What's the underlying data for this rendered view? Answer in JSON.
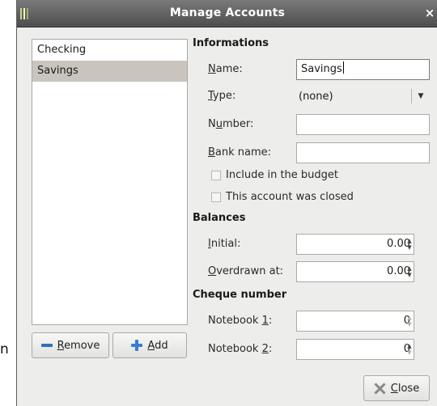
{
  "background": {
    "letter": "n"
  },
  "window": {
    "title": "Manage Accounts",
    "close_glyph": "×"
  },
  "accounts": [
    "Checking",
    "Savings"
  ],
  "selected_account": "Savings",
  "buttons": {
    "remove_u": "R",
    "remove_rest": "emove",
    "add_u": "A",
    "add_rest": "dd",
    "close_u": "C",
    "close_rest": "lose"
  },
  "informations": {
    "heading": "Informations",
    "name_u": "N",
    "name_rest": "ame:",
    "name_value": "Savings",
    "type_u": "T",
    "type_rest": "ype:",
    "type_value": "(none)",
    "number_a": "N",
    "number_u": "u",
    "number_rest": "mber:",
    "number_value": "",
    "bank_u": "B",
    "bank_rest": "ank name:",
    "bank_value": "",
    "include_budget_label": "Include in the budget",
    "include_budget_checked": false,
    "closed_label": "This account was closed",
    "closed_checked": false
  },
  "balances": {
    "heading": "Balances",
    "initial_u": "I",
    "initial_rest": "nitial:",
    "initial_value": "0.00",
    "overdrawn_u": "O",
    "overdrawn_rest": "verdrawn at:",
    "overdrawn_value": "0.00"
  },
  "cheque": {
    "heading": "Cheque number",
    "nb1_prefix": "Notebook ",
    "nb1_u": "1",
    "nb1_suffix": ":",
    "nb1_value": "0",
    "nb2_prefix": "Notebook ",
    "nb2_u": "2",
    "nb2_suffix": ":",
    "nb2_value": "0"
  },
  "colors": {
    "titlebar": "#5e5e5e",
    "selection": "#c9c5bd",
    "accent_icon": "#3a7bd5"
  },
  "icons": {
    "remove": "minus-icon",
    "add": "plus-icon",
    "close": "close-icon",
    "app": "app-icon"
  }
}
